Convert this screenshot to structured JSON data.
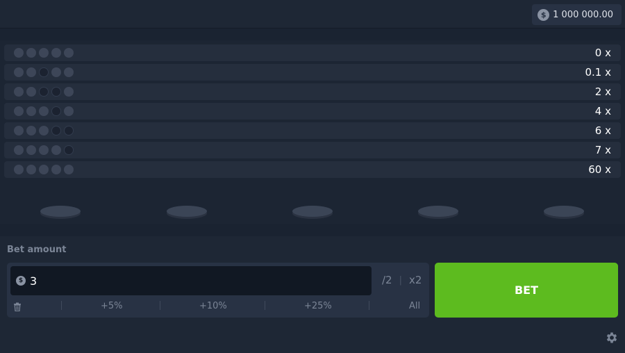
{
  "header": {
    "balance_value": "1 000 000.00",
    "currency_icon": "dollar-coin-icon"
  },
  "board": {
    "rows": [
      {
        "multiplier": "0 x",
        "dots": [
          "lit",
          "lit",
          "lit",
          "lit",
          "lit"
        ]
      },
      {
        "multiplier": "0.1 x",
        "dots": [
          "lit",
          "lit",
          "dark",
          "lit",
          "lit"
        ]
      },
      {
        "multiplier": "2 x",
        "dots": [
          "lit",
          "lit",
          "dark",
          "dark",
          "lit"
        ]
      },
      {
        "multiplier": "4 x",
        "dots": [
          "lit",
          "lit",
          "lit",
          "dark",
          "lit"
        ]
      },
      {
        "multiplier": "6 x",
        "dots": [
          "lit",
          "lit",
          "lit",
          "dark",
          "dark"
        ]
      },
      {
        "multiplier": "7 x",
        "dots": [
          "lit",
          "lit",
          "lit",
          "lit",
          "dark"
        ]
      },
      {
        "multiplier": "60 x",
        "dots": [
          "lit",
          "lit",
          "lit",
          "lit",
          "lit"
        ]
      }
    ],
    "pad_count": 5
  },
  "bet": {
    "label": "Bet amount",
    "amount": "3",
    "half_label": "/2",
    "separator": "|",
    "double_label": "x2",
    "quick_options": [
      "+5%",
      "+10%",
      "+25%",
      "All"
    ],
    "button_label": "BET"
  },
  "colors": {
    "background": "#1a2331",
    "accent_green": "#5dbb1f",
    "row_bg": "#252e3d"
  }
}
